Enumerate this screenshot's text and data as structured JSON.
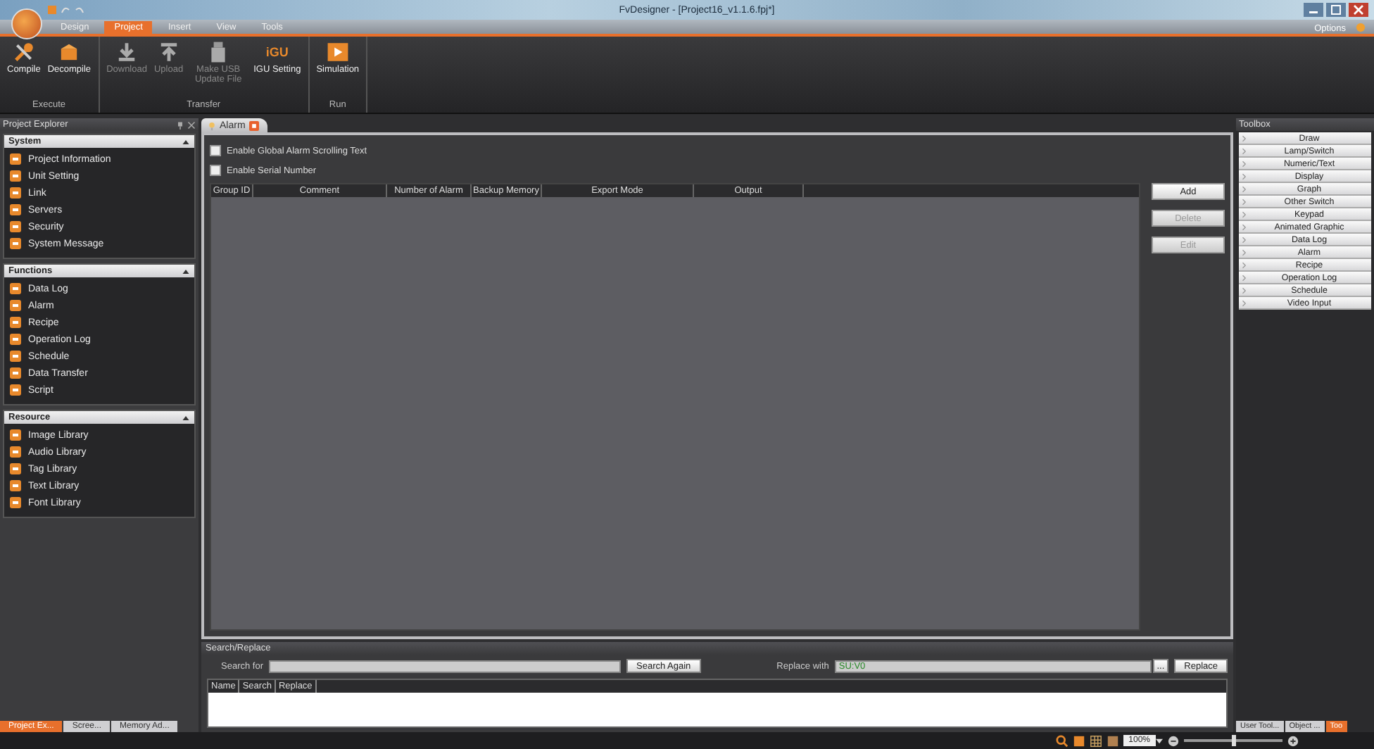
{
  "title_bar": {
    "title": "FvDesigner - [Project16_v1.1.6.fpj*]"
  },
  "ribbon_tabs": [
    {
      "label": "Design",
      "selected": false
    },
    {
      "label": "Project",
      "selected": true
    },
    {
      "label": "Insert",
      "selected": false
    },
    {
      "label": "View",
      "selected": false
    },
    {
      "label": "Tools",
      "selected": false
    }
  ],
  "options_menu": "Options",
  "ribbon_groups": [
    {
      "label": "Execute",
      "buttons": [
        {
          "label": "Compile",
          "kind": "wrench",
          "disabled": false
        },
        {
          "label": "Decompile",
          "kind": "box",
          "disabled": false
        }
      ]
    },
    {
      "label": "Transfer",
      "buttons": [
        {
          "label": "Download",
          "kind": "download",
          "disabled": true
        },
        {
          "label": "Upload",
          "kind": "upload",
          "disabled": true
        },
        {
          "label": "Make USB Update File",
          "kind": "usb",
          "disabled": true
        },
        {
          "label": "IGU Setting",
          "kind": "igu",
          "logo_text": "iGU",
          "disabled": false
        }
      ]
    },
    {
      "label": "Run",
      "buttons": [
        {
          "label": "Simulation",
          "kind": "play",
          "disabled": false
        }
      ]
    }
  ],
  "project_explorer": {
    "title": "Project Explorer",
    "sections": [
      {
        "title": "System",
        "expanded": true,
        "items": [
          "Project Information",
          "Unit Setting",
          "Link",
          "Servers",
          "Security",
          "System Message"
        ]
      },
      {
        "title": "Functions",
        "expanded": true,
        "items": [
          "Data Log",
          "Alarm",
          "Recipe",
          "Operation Log",
          "Schedule",
          "Data Transfer",
          "Script"
        ]
      },
      {
        "title": "Resource",
        "expanded": true,
        "items": [
          "Image Library",
          "Audio Library",
          "Tag Library",
          "Text Library",
          "Font Library"
        ]
      }
    ],
    "tabs": [
      {
        "label": "Project Ex...",
        "selected": true
      },
      {
        "label": "Scree...",
        "selected": false
      },
      {
        "label": "Memory Ad...",
        "selected": false
      }
    ]
  },
  "document_tab": {
    "label": "Alarm"
  },
  "alarm": {
    "options": [
      {
        "label": "Enable Global Alarm Scrolling Text",
        "checked": false
      },
      {
        "label": "Enable Serial Number",
        "checked": false
      }
    ],
    "columns": [
      "Group ID",
      "Comment",
      "Number of Alarm",
      "Backup Memory",
      "Export Mode",
      "Output"
    ],
    "buttons": [
      {
        "label": "Add",
        "disabled": false
      },
      {
        "label": "Delete",
        "disabled": true
      },
      {
        "label": "Edit",
        "disabled": true
      }
    ]
  },
  "search_replace": {
    "title": "Search/Replace",
    "search_label": "Search for",
    "search_button": "Search Again",
    "replace_label": "Replace with",
    "replace_value": "SU:V0",
    "browse_button": "...",
    "replace_button": "Replace",
    "columns": [
      "Name",
      "Search",
      "Replace"
    ]
  },
  "toolbox": {
    "title": "Toolbox",
    "items": [
      "Draw",
      "Lamp/Switch",
      "Numeric/Text",
      "Display",
      "Graph",
      "Other Switch",
      "Keypad",
      "Animated Graphic",
      "Data Log",
      "Alarm",
      "Recipe",
      "Operation Log",
      "Schedule",
      "Video Input"
    ],
    "tabs": [
      {
        "label": "User Tool...",
        "selected": false
      },
      {
        "label": "Object ...",
        "selected": false
      },
      {
        "label": "Too",
        "selected": true
      }
    ]
  },
  "status_bar": {
    "zoom": "100%",
    "zoom_slider": {
      "level": 0.5
    }
  }
}
